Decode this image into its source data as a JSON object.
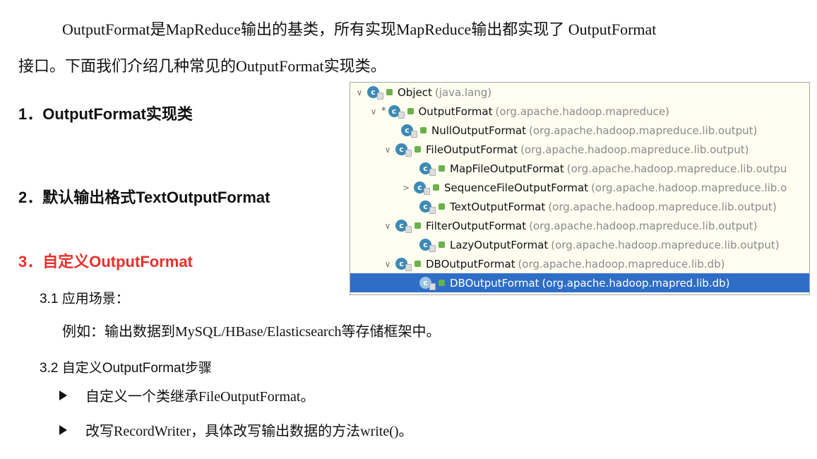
{
  "intro": {
    "line1": "OutputFormat是MapReduce输出的基类，所有实现MapReduce输出都实现了 OutputFormat",
    "line2": "接口。下面我们介绍几种常见的OutputFormat实现类。"
  },
  "headings": {
    "h1": "1．OutputFormat实现类",
    "h2": "2．默认输出格式TextOutputFormat",
    "h3": "3．自定义OutputFormat",
    "h3_color": "#e8302a"
  },
  "section31": {
    "title": "3.1 应用场景：",
    "example": "例如：输出数据到MySQL/HBase/Elasticsearch等存储框架中。"
  },
  "section32": {
    "title": "3.2 自定义OutputFormat步骤",
    "bullets": [
      "自定义一个类继承FileOutputFormat。",
      "改写RecordWriter，具体改写输出数据的方法write()。"
    ]
  },
  "hierarchy": {
    "rows": [
      {
        "name": "Object",
        "pkg": "(java.lang)",
        "expand": "v",
        "star": false,
        "selected": false
      },
      {
        "name": "OutputFormat",
        "pkg": "(org.apache.hadoop.mapreduce)",
        "expand": "v",
        "star": true,
        "selected": false
      },
      {
        "name": "NullOutputFormat",
        "pkg": "(org.apache.hadoop.mapreduce.lib.output)",
        "expand": "",
        "star": false,
        "selected": false
      },
      {
        "name": "FileOutputFormat",
        "pkg": "(org.apache.hadoop.mapreduce.lib.output)",
        "expand": "v",
        "star": false,
        "selected": false
      },
      {
        "name": "MapFileOutputFormat",
        "pkg": "(org.apache.hadoop.mapreduce.lib.outpu",
        "expand": "",
        "star": false,
        "selected": false
      },
      {
        "name": "SequenceFileOutputFormat",
        "pkg": "(org.apache.hadoop.mapreduce.lib.o",
        "expand": ">",
        "star": false,
        "selected": false
      },
      {
        "name": "TextOutputFormat",
        "pkg": "(org.apache.hadoop.mapreduce.lib.output)",
        "expand": "",
        "star": false,
        "selected": false
      },
      {
        "name": "FilterOutputFormat",
        "pkg": "(org.apache.hadoop.mapreduce.lib.output)",
        "expand": "v",
        "star": false,
        "selected": false
      },
      {
        "name": "LazyOutputFormat",
        "pkg": "(org.apache.hadoop.mapreduce.lib.output)",
        "expand": "",
        "star": false,
        "selected": false
      },
      {
        "name": "DBOutputFormat",
        "pkg": "(org.apache.hadoop.mapreduce.lib.db)",
        "expand": "v",
        "star": false,
        "selected": false
      },
      {
        "name": "DBOutputFormat",
        "pkg": "(org.apache.hadoop.mapred.lib.db)",
        "expand": "",
        "star": false,
        "selected": true
      }
    ],
    "class_icon_letter": "c",
    "selection_color": "#2f6ec6"
  }
}
